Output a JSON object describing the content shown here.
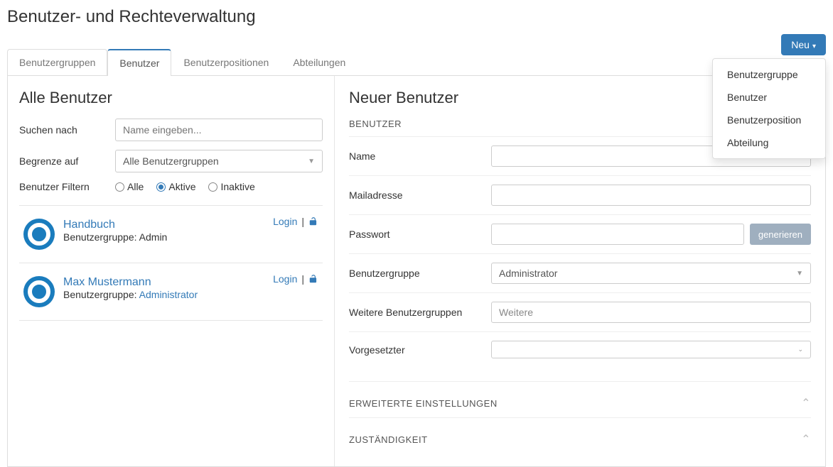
{
  "page": {
    "title": "Benutzer- und Rechteverwaltung"
  },
  "newButton": {
    "label": "Neu",
    "menu": [
      "Benutzergruppe",
      "Benutzer",
      "Benutzerposition",
      "Abteilung"
    ]
  },
  "tabs": [
    {
      "label": "Benutzergruppen",
      "active": false
    },
    {
      "label": "Benutzer",
      "active": true
    },
    {
      "label": "Benutzerpositionen",
      "active": false
    },
    {
      "label": "Abteilungen",
      "active": false
    }
  ],
  "left": {
    "title": "Alle Benutzer",
    "searchLabel": "Suchen nach",
    "searchPlaceholder": "Name eingeben...",
    "limitLabel": "Begrenze auf",
    "limitValue": "Alle Benutzergruppen",
    "filterLabel": "Benutzer Filtern",
    "radios": {
      "all": "Alle",
      "active": "Aktive",
      "inactive": "Inaktive",
      "selected": "active"
    },
    "loginLabel": "Login",
    "groupPrefix": "Benutzergruppe:",
    "users": [
      {
        "name": "Handbuch",
        "group": "Admin",
        "groupLink": false
      },
      {
        "name": "Max Mustermann",
        "group": "Administrator",
        "groupLink": true
      }
    ]
  },
  "right": {
    "title": "Neuer Benutzer",
    "sections": {
      "user": "BENUTZER",
      "extended": "ERWEITERTE EINSTELLUNGEN",
      "responsibility": "ZUSTÄNDIGKEIT"
    },
    "fields": {
      "name": "Name",
      "mail": "Mailadresse",
      "password": "Passwort",
      "generate": "generieren",
      "group": "Benutzergruppe",
      "groupValue": "Administrator",
      "moreGroups": "Weitere Benutzergruppen",
      "moreGroupsValue": "Weitere",
      "supervisor": "Vorgesetzter"
    }
  }
}
